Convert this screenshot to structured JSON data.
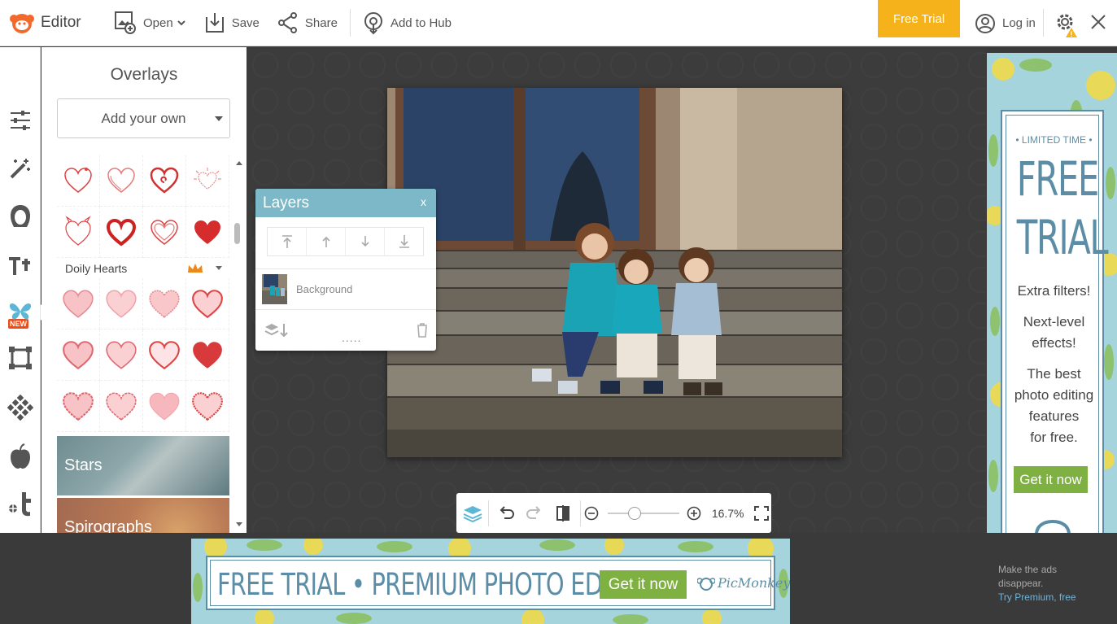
{
  "topbar": {
    "app_title": "Editor",
    "open_label": "Open",
    "save_label": "Save",
    "share_label": "Share",
    "hub_label": "Add to Hub",
    "free_trial_label": "Free Trial",
    "login_label": "Log in"
  },
  "rail": {
    "items": [
      "adjust-icon",
      "effects-wand-icon",
      "touch-up-face-icon",
      "text-icon",
      "overlays-butterfly-icon",
      "frames-icon",
      "textures-icon",
      "themes-apple-icon",
      "graphics-icon"
    ],
    "new_badge": "NEW"
  },
  "overlays_panel": {
    "title": "Overlays",
    "add_own_label": "Add your own",
    "category_doily": "Doily Hearts",
    "category_stars": "Stars",
    "category_spirographs": "Spirographs"
  },
  "layers": {
    "title": "Layers",
    "close_label": "x",
    "layer_name": "Background",
    "dots": "....."
  },
  "canvas_toolbar": {
    "zoom_value": "16.7%",
    "zoom_level": 0.35
  },
  "right_ad": {
    "limited": "• LIMITED TIME •",
    "free": "FREE",
    "trial": "TRIAL",
    "line1": "Extra filters!",
    "line2a": "Next-level",
    "line2b": "effects!",
    "line3a": "The best",
    "line3b": "photo editing",
    "line3c": "features",
    "line3d": "for free.",
    "cta": "Get it now"
  },
  "bottom_ad": {
    "headline": "FREE TRIAL • PREMIUM PHOTO EDITOR",
    "cta": "Get it now",
    "brand": "PicMonkey"
  },
  "ad_note": {
    "line1": "Make the ads",
    "line2": "disappear.",
    "link": "Try Premium, free"
  },
  "colors": {
    "accent_orange": "#f6b21b",
    "layers_header": "#7cb8c7",
    "ad_blue": "#5b8ea6",
    "ad_green": "#7fb042",
    "rail_icon": "#555555",
    "rail_active": "#5cb6d6"
  }
}
